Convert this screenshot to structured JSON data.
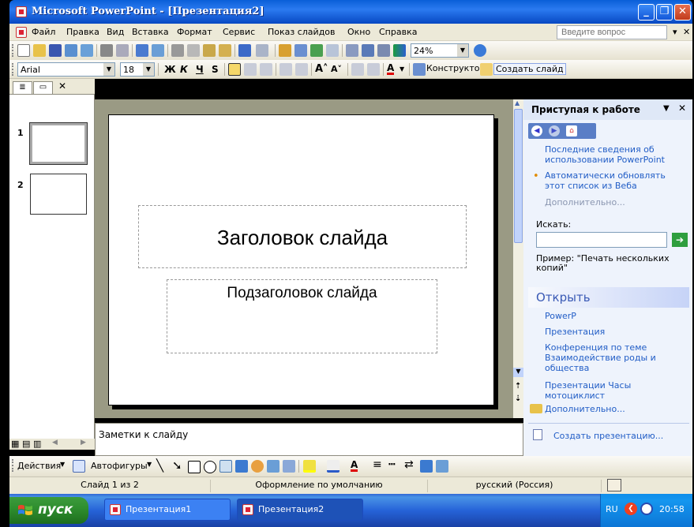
{
  "window": {
    "title": "Microsoft PowerPoint - [Презентация2]"
  },
  "menu": {
    "items": [
      "Файл",
      "Правка",
      "Вид",
      "Вставка",
      "Формат",
      "Сервис",
      "Показ слайдов",
      "Окно",
      "Справка"
    ],
    "ask_placeholder": "Введите вопрос"
  },
  "toolbar": {
    "zoom": "24%"
  },
  "format": {
    "font": "Arial",
    "size": "18",
    "bold": "Ж",
    "italic": "К",
    "underline": "Ч",
    "shadow": "S",
    "designer": "Конструктор",
    "new_slide": "Создать слайд"
  },
  "slides_panel": {
    "thumbs": [
      "1",
      "2"
    ]
  },
  "slide": {
    "title": "Заголовок слайда",
    "subtitle": "Подзаголовок слайда"
  },
  "notes": {
    "placeholder": "Заметки к слайду"
  },
  "taskpane": {
    "title": "Приступая к работе",
    "items": [
      {
        "text": "Последние сведения об использовании PowerPoint"
      },
      {
        "text": "Автоматически обновлять этот список из Веба"
      }
    ],
    "more": "Дополнительно...",
    "search_label": "Искать:",
    "example": "Пример: \"Печать нескольких копий\"",
    "open_title": "Открыть",
    "recent": [
      "PowerP",
      "Презентация",
      "Конференция по теме Взаимодействие роды и общества",
      "Презентации Часы мотоциклист"
    ],
    "more_files": "Дополнительно...",
    "create": "Создать презентацию..."
  },
  "drawing": {
    "actions": "Действия",
    "autoshapes": "Автофигуры"
  },
  "status": {
    "slide": "Слайд 1 из 2",
    "design": "Оформление по умолчанию",
    "language": "русский (Россия)"
  },
  "taskbar": {
    "start": "пуск",
    "buttons": [
      "Презентация1",
      "Презентация2"
    ],
    "lang": "RU",
    "time": "20:58"
  }
}
